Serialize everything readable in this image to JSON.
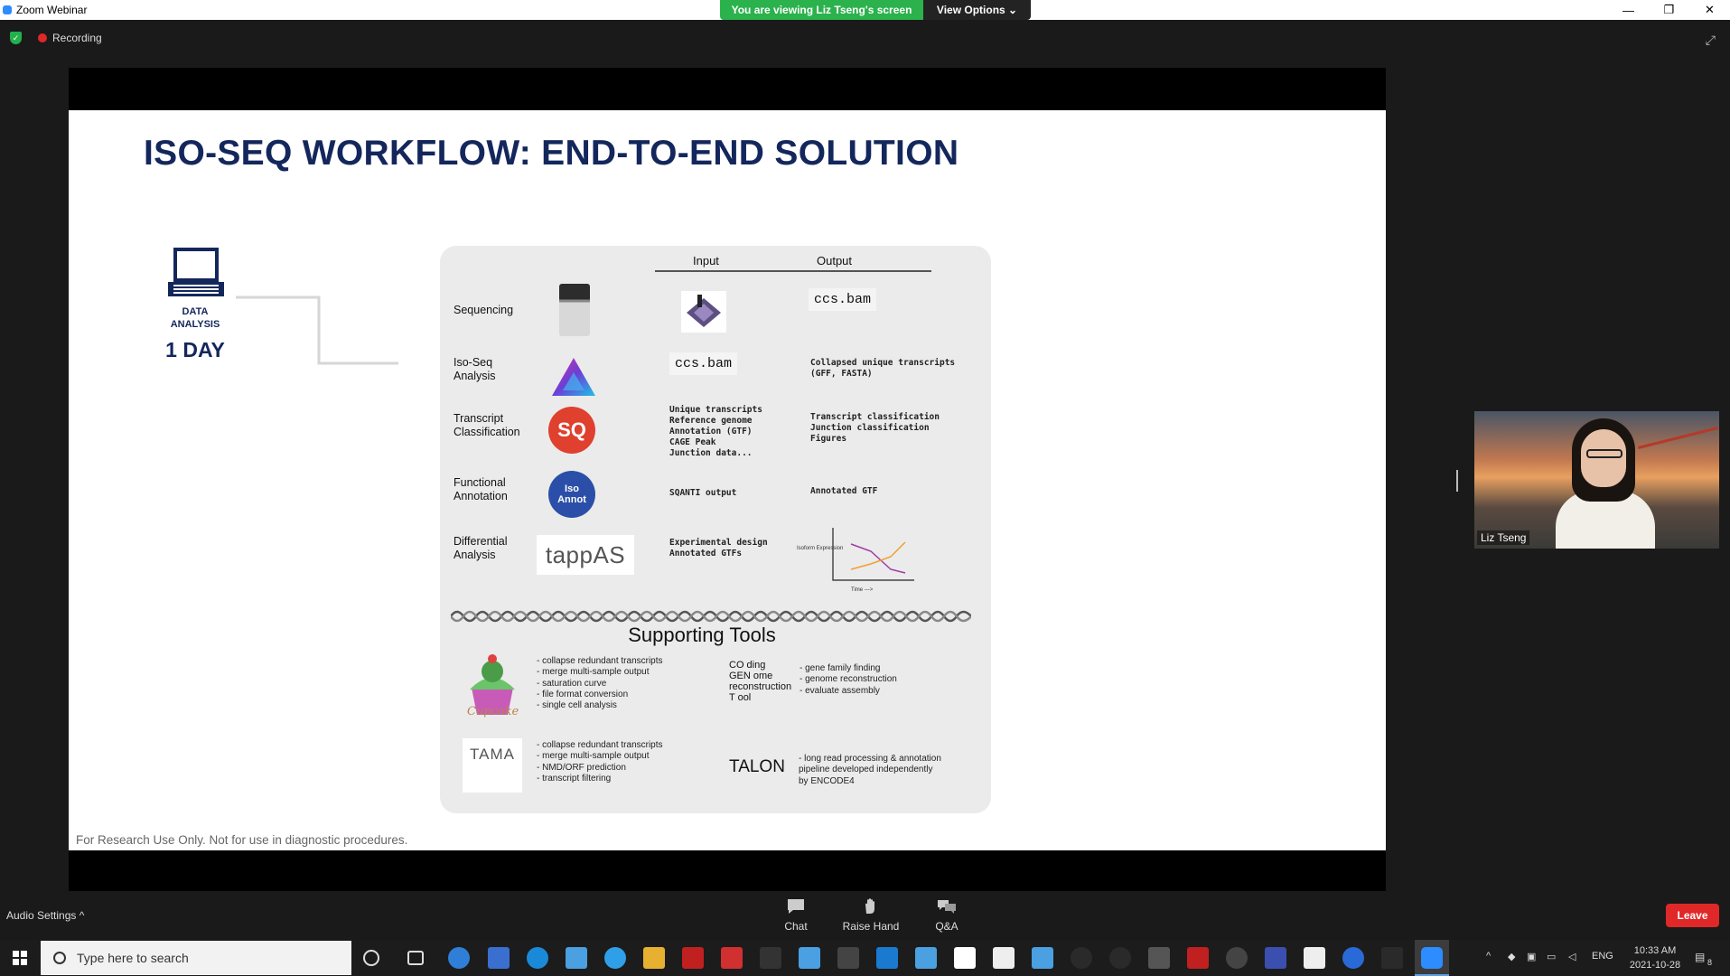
{
  "window": {
    "title": "Zoom Webinar",
    "minimize_glyph": "—",
    "restore_glyph": "❐",
    "close_glyph": "✕"
  },
  "banner": {
    "viewing_text": "You are viewing Liz Tseng's screen",
    "view_options": "View Options ⌄"
  },
  "status": {
    "recording": "Recording"
  },
  "slide": {
    "title": "ISO-SEQ WORKFLOW: END-TO-END SOLUTION",
    "data_analysis": "DATA\nANALYSIS",
    "duration": "1 DAY",
    "table_headers": {
      "input": "Input",
      "output": "Output"
    },
    "rows": [
      {
        "label": "Sequencing",
        "input": "",
        "output": "ccs.bam"
      },
      {
        "label": "Iso-Seq\nAnalysis",
        "input": "ccs.bam",
        "output": "Collapsed unique transcripts\n(GFF, FASTA)"
      },
      {
        "label": "Transcript\nClassification",
        "input": "Unique transcripts\nReference genome\nAnnotation (GTF)\nCAGE Peak\nJunction data...",
        "output": "Transcript classification\nJunction classification\nFigures"
      },
      {
        "label": "Functional\nAnnotation",
        "input": "SQANTI output",
        "output": "Annotated GTF"
      },
      {
        "label": "Differential\nAnalysis",
        "input": "Experimental design\nAnnotated GTFs",
        "output": ""
      }
    ],
    "logos": {
      "sqanti": "SQ",
      "isoannot_1": "Iso",
      "isoannot_2": "Annot",
      "tappas": "tappAS"
    },
    "mini_chart": {
      "ylabel": "Isoform\nExpression",
      "xlabel": "Time --->"
    },
    "supporting_title": "Supporting Tools",
    "tools": {
      "cupcake_name": "Cupcake",
      "cupcake_items": "- collapse redundant transcripts\n- merge multi-sample output\n- saturation curve\n- file format conversion\n- single cell analysis",
      "cogent_name": "CO ding\nGEN ome\nreconstruction\nT ool",
      "cogent_items": "- gene family finding\n- genome reconstruction\n- evaluate assembly",
      "tama_name": "TAMA",
      "tama_items": "- collapse redundant transcripts\n- merge multi-sample output\n- NMD/ORF prediction\n- transcript filtering",
      "talon_name": "TALON",
      "talon_items": "- long read processing & annotation\npipeline developed independently\nby ENCODE4"
    },
    "footnote": "For Research Use Only. Not for use in diagnostic procedures."
  },
  "video": {
    "participant": "Liz Tseng"
  },
  "controls": {
    "audio_settings": "Audio Settings  ^",
    "chat": "Chat",
    "raise_hand": "Raise Hand",
    "qa": "Q&A",
    "leave": "Leave"
  },
  "taskbar": {
    "search_placeholder": "Type here to search",
    "language": "ENG",
    "time": "10:33 AM",
    "date": "2021-10-28",
    "notification_count": "8"
  },
  "colors": {
    "zoom_blue": "#2d8cff",
    "banner_green": "#2bb24c",
    "leave_red": "#e02828",
    "title_navy": "#14275c"
  }
}
